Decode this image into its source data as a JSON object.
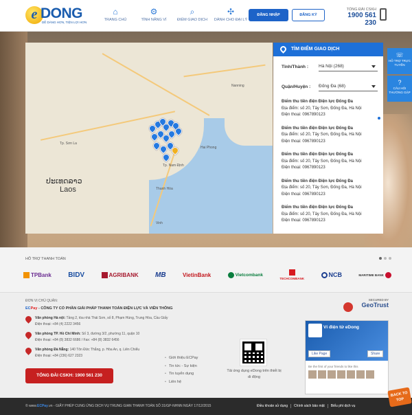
{
  "header": {
    "logo_letter": "e",
    "logo_text": "DONG",
    "logo_slogan": "DỄ DÀNG HƠN, TIỆN LỢI HƠN",
    "nav": [
      {
        "label": "TRANG CHỦ",
        "icon": "home-icon"
      },
      {
        "label": "TÍNH NĂNG VÍ",
        "icon": "gear-icon"
      },
      {
        "label": "ĐIỂM GIAO DỊCH",
        "icon": "location-search-icon"
      },
      {
        "label": "DÀNH CHO ĐẠI LÝ",
        "icon": "network-icon"
      }
    ],
    "login_label": "ĐĂNG NHẬP",
    "register_label": "ĐĂNG KÝ",
    "hotline_label": "TỔNG ĐÀI CSKH",
    "hotline_number": "1900 561 230"
  },
  "panel": {
    "title": "TÌM ĐIỂM GIAO DỊCH",
    "province_label": "Tỉnh/Thành :",
    "province_value": "Hà Nội (268)",
    "district_label": "Quận/Huyện :",
    "district_value": "Đống Đa (68)",
    "results": [
      {
        "name": "Điểm thu tiền điện Điện lực Đống Đa",
        "address": "Địa điểm: số 20, Tây Sơn, Đống Đa, Hà Nội",
        "phone": "Điện thoại: 0967890123"
      },
      {
        "name": "Điểm thu tiền điện Điện lực Đống Đa",
        "address": "Địa điểm: số 20, Tây Sơn, Đống Đa, Hà Nội",
        "phone": "Điện thoại: 0967890123"
      },
      {
        "name": "Điểm thu tiền điện Điện lực Đống Đa",
        "address": "Địa điểm: số 20, Tây Sơn, Đống Đa, Hà Nội",
        "phone": "Điện thoại: 0967890123"
      },
      {
        "name": "Điểm thu tiền điện Điện lực Đống Đa",
        "address": "Địa điểm: số 20, Tây Sơn, Đống Đa, Hà Nội",
        "phone": "Điện thoại: 0967890123"
      },
      {
        "name": "Điểm thu tiền điện Điện lực Đống Đa",
        "address": "Địa điểm: số 20, Tây Sơn, Đống Đa, Hà Nội",
        "phone": "Điện thoại: 0967890123"
      }
    ]
  },
  "side_widgets": [
    {
      "label": "HỖ TRỢ TRỰC TUYẾN",
      "icon": "chat-icon"
    },
    {
      "label": "CÂU HỎI THƯỜNG GẶP",
      "icon": "question-icon"
    }
  ],
  "map": {
    "labels": [
      "Tp. Sơn La",
      "Vinh",
      "Tp. Nam Định",
      "Thanh Hóa",
      "Nanning",
      "Hai Phong"
    ],
    "country": "ປະເທດລາວ",
    "country_latin": "Laos"
  },
  "partners": {
    "title": "HỖ TRỢ THANH TOÁN",
    "banks": [
      "TPBank",
      "BIDV",
      "AGRIBANK",
      "MB",
      "VietinBank",
      "Vietcombank",
      "TECHCOMBANK",
      "NCB",
      "MARITIME BANK"
    ]
  },
  "footer": {
    "unit_label": "ĐƠN VỊ CHỦ QUẢN:",
    "company_ec": "EC",
    "company_pay": "Pay",
    "company_name": " - CÔNG TY CỔ PHẦN GIẢI PHÁP THANH TOÁN ĐIỆN LỰC VÀ VIỄN THÔNG",
    "offices": [
      {
        "title": "Văn phòng Hà nội:",
        "address": "Tầng 2, tòa nhà Thái Sơn, số 8, Phạm Hùng, Trung Hòa, Cầu Giấy",
        "phone": "Điện thoại: +84 (4) 2222 3456"
      },
      {
        "title": "Văn phòng TP. Hồ Chí Minh:",
        "address": "Số 3, đường 3/2, phường 11, quận 10",
        "phone": "Điện thoại: +84 (8) 3832 6686 / Fax: +84 (8) 3832 6456"
      },
      {
        "title": "Văn phòng Đà Nẵng:",
        "address": "140 Tôn Đức Thắng, p. Hòa An, q. Liên Chiểu",
        "phone": "Điện thoại: +84 (236) 627 2323"
      }
    ],
    "hotline_btn": "TỔNG ĐÀI CSKH:  1900 561 230",
    "links": [
      "Giới thiệu ECPay",
      "Tin tức - Sự kiện",
      "Tin tuyển dụng",
      "Liên hệ"
    ],
    "qr_text": "Tải ứng dụng eDong trên thiết bị di động",
    "geotrust_secured": "SECURED BY",
    "geotrust_name": "GeoTrust",
    "fb_title": "Ví điện tử eDong",
    "fb_like": "Like Page",
    "fb_share": "Share",
    "fb_friends": "Be the first of your friends to like this"
  },
  "bottom": {
    "copyright_prefix": "© www.",
    "copyright_brand": "ECPay",
    "copyright_suffix": ".vn  -  GIẤY PHÉP CUNG ỨNG DỊCH VỤ TRUNG GIAN THANH TOÁN SỐ 31/GP-NHNN NGÀY 17/12/2015",
    "links": [
      "Điều khoản sử dụng",
      "Chính sách bảo mật",
      "Biểu phí dịch vụ"
    ],
    "back_to_top": "BACK TO TOP"
  }
}
